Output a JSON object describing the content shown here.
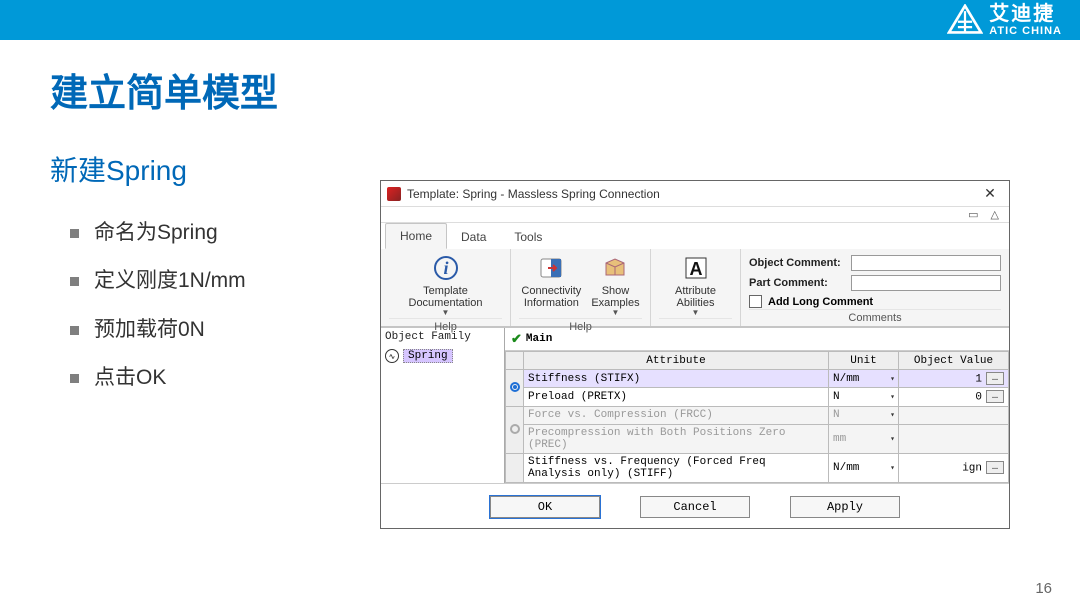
{
  "brand": {
    "cn": "艾迪捷",
    "en": "ATIC CHINA"
  },
  "slide_title": "建立简单模型",
  "section_title": "新建Spring",
  "bullets": [
    "命名为Spring",
    "定义刚度1N/mm",
    "预加载荷0N",
    "点击OK"
  ],
  "page_number": "16",
  "dialog": {
    "title": "Template: Spring - Massless Spring Connection",
    "tabs": {
      "home": "Home",
      "data": "Data",
      "tools": "Tools"
    },
    "ribbon": {
      "template_doc": "Template Documentation",
      "connectivity": "Connectivity\nInformation",
      "show_examples": "Show\nExamples",
      "help_label": "Help",
      "attribute_abilities": "Attribute Abilities",
      "object_comment": "Object Comment:",
      "part_comment": "Part Comment:",
      "add_long_comment": "Add Long Comment",
      "comments_label": "Comments"
    },
    "tree": {
      "header": "Object Family",
      "item": "Spring"
    },
    "main_tab": "Main",
    "grid": {
      "headers": {
        "attribute": "Attribute",
        "unit": "Unit",
        "value": "Object Value"
      },
      "rows": [
        {
          "attr": "Stiffness (STIFX)",
          "unit": "N/mm",
          "value": "1",
          "highlight": true,
          "radio": "filled",
          "has_more": true
        },
        {
          "attr": "Preload (PRETX)",
          "unit": "N",
          "value": "0",
          "radio": "empty",
          "has_more": true
        },
        {
          "attr": "Force vs. Compression (FRCC)",
          "unit": "N",
          "value": "",
          "disabled": true,
          "radio": "gray"
        },
        {
          "attr": "Precompression with Both Positions Zero (PREC)",
          "unit": "mm",
          "value": "",
          "disabled": true,
          "radio": "none"
        },
        {
          "attr": "Stiffness vs. Frequency (Forced Freq Analysis only) (STIFF)",
          "unit": "N/mm",
          "value": "ign",
          "has_more": true
        }
      ]
    },
    "buttons": {
      "ok": "OK",
      "cancel": "Cancel",
      "apply": "Apply"
    }
  }
}
